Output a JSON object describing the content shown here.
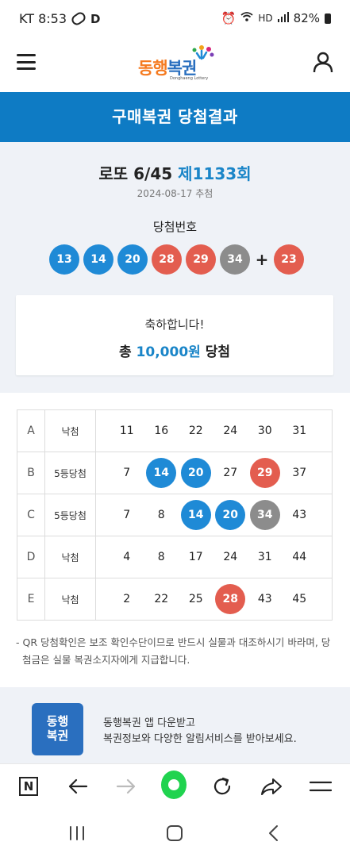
{
  "status_bar": {
    "carrier_time": "KT 8:53",
    "d_icon": "D",
    "hd_badge": "HD",
    "battery": "82%"
  },
  "header": {
    "logo_text_1": "동행",
    "logo_text_2": "복권",
    "logo_sub": "Donghaeng Lottery",
    "menu_icon": "hamburger-icon",
    "user_icon": "user-icon"
  },
  "banner": {
    "title": "구매복권 당첨결과"
  },
  "result": {
    "game": "로또 6/45",
    "round": "제1133회",
    "draw_date": "2024-08-17 추첨",
    "winning_label": "당첨번호",
    "winning_numbers": [
      "13",
      "14",
      "20",
      "28",
      "29",
      "34"
    ],
    "plus": "+",
    "bonus_number": "23",
    "congrats_line": "축하합니다!",
    "total_prefix": "총",
    "total_amount": "10,000원",
    "total_suffix": "당첨"
  },
  "tickets": [
    {
      "label": "A",
      "result": "낙첨",
      "numbers": [
        "11",
        "16",
        "22",
        "24",
        "30",
        "31"
      ]
    },
    {
      "label": "B",
      "result": "5등당첨",
      "numbers": [
        "7",
        "14",
        "20",
        "27",
        "29",
        "37"
      ]
    },
    {
      "label": "C",
      "result": "5등당첨",
      "numbers": [
        "7",
        "8",
        "14",
        "20",
        "34",
        "43"
      ]
    },
    {
      "label": "D",
      "result": "낙첨",
      "numbers": [
        "4",
        "8",
        "17",
        "24",
        "31",
        "44"
      ]
    },
    {
      "label": "E",
      "result": "낙첨",
      "numbers": [
        "2",
        "22",
        "25",
        "28",
        "43",
        "45"
      ]
    }
  ],
  "notice": {
    "line1": "- QR 당첨확인은 보조 확인수단이므로 반드시 실물과 대조하시기 바라며, 당",
    "line2": "첨금은 실물 복권소지자에게 지급합니다."
  },
  "promo": {
    "logo_line1": "동행",
    "logo_line2": "복권",
    "line1": "동행복권 앱 다운받고",
    "line2": "복권정보와 다양한 알림서비스를 받아보세요."
  },
  "toolbar": {
    "n_label": "N"
  },
  "colors": {
    "primary_blue": "#0e7bc4",
    "ball_blue": "#1f8ad6",
    "ball_red": "#e35d4f",
    "ball_gray": "#8c8c8c",
    "toolbar_green": "#20d34f"
  }
}
